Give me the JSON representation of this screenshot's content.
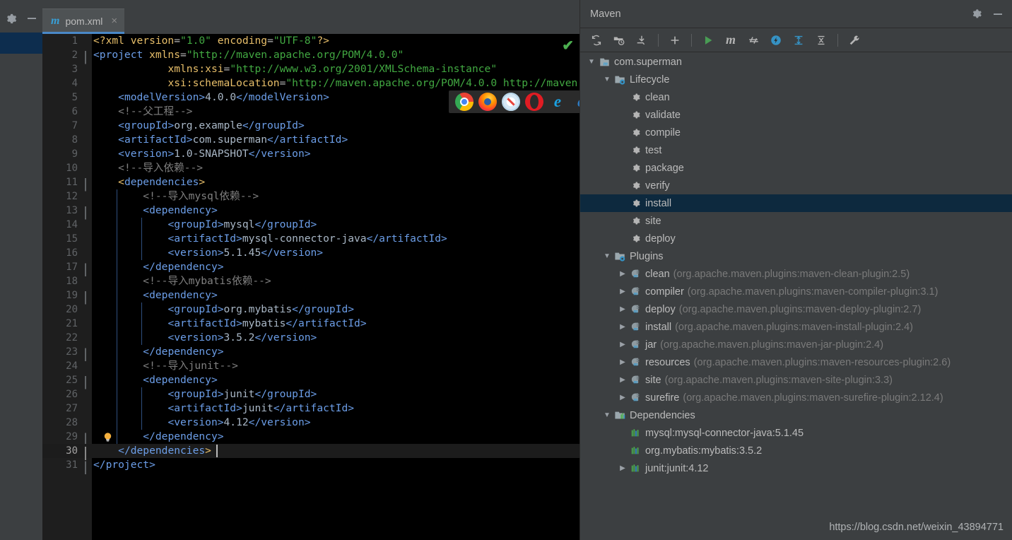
{
  "editor": {
    "tab": {
      "label": "pom.xml",
      "icon": "maven-m-icon",
      "close_icon": "×"
    },
    "toolbar_icons": [
      "gear-icon",
      "minimize-icon"
    ],
    "validation_status": "✔",
    "browser_icons": [
      "chrome-icon",
      "firefox-icon",
      "safari-icon",
      "opera-icon",
      "internet-explorer-icon",
      "edge-icon"
    ],
    "caret_line": 30,
    "lines": [
      {
        "n": 1,
        "html": "<span class='pi'>&lt;?xml </span><span class='attrn'>version</span><span class='attr'>=</span><span class='str'>\"1.0\"</span><span class='attr'> </span><span class='attrn'>encoding</span><span class='attr'>=</span><span class='str'>\"UTF-8\"</span><span class='pi'>?&gt;</span>"
      },
      {
        "n": 2,
        "html": "<span class='tagn'>&lt;project </span><span class='attrn'>xmlns</span><span class='attr'>=</span><span class='str'>\"http://maven.apache.org/POM/4.0.0\"</span>"
      },
      {
        "n": 3,
        "html": "            <span class='attrn'>xmlns:xsi</span><span class='attr'>=</span><span class='str'>\"http://www.w3.org/2001/XMLSchema-instance\"</span>"
      },
      {
        "n": 4,
        "html": "            <span class='attrn'>xsi:schemaLocation</span><span class='attr'>=</span><span class='str'>\"http://maven.apache.org/POM/4.0.0 http://maven.</span>"
      },
      {
        "n": 5,
        "html": "    <span class='tagn'>&lt;modelVersion&gt;</span><span class='txt'>4.0.0</span><span class='tagn'>&lt;/modelVersion&gt;</span>"
      },
      {
        "n": 6,
        "html": "    <span class='cmt'>&lt;!--父工程--&gt;</span>"
      },
      {
        "n": 7,
        "html": "    <span class='tagn'>&lt;groupId&gt;</span><span class='txt'>org.example</span><span class='tagn'>&lt;/groupId&gt;</span>"
      },
      {
        "n": 8,
        "html": "    <span class='tagn'>&lt;artifactId&gt;</span><span class='txt'>com.superman</span><span class='tagn'>&lt;/artifactId&gt;</span>"
      },
      {
        "n": 9,
        "html": "    <span class='tagn'>&lt;version&gt;</span><span class='txt'>1.0-SNAPSHOT</span><span class='tagn'>&lt;/version&gt;</span>"
      },
      {
        "n": 10,
        "html": "    <span class='cmt'>&lt;!--导入依赖--&gt;</span>"
      },
      {
        "n": 11,
        "html": "    <span class='br'>&lt;</span><span class='tagn'>dependencies</span><span class='br'>&gt;</span>"
      },
      {
        "n": 12,
        "html": "        <span class='cmt'>&lt;!--导入mysql依赖--&gt;</span>"
      },
      {
        "n": 13,
        "html": "        <span class='tagn'>&lt;dependency&gt;</span>"
      },
      {
        "n": 14,
        "html": "            <span class='tagn'>&lt;groupId&gt;</span><span class='txt'>mysql</span><span class='tagn'>&lt;/groupId&gt;</span>"
      },
      {
        "n": 15,
        "html": "            <span class='tagn'>&lt;artifactId&gt;</span><span class='txt'>mysql-connector-java</span><span class='tagn'>&lt;/artifactId&gt;</span>"
      },
      {
        "n": 16,
        "html": "            <span class='tagn'>&lt;version&gt;</span><span class='txt'>5.1.45</span><span class='tagn'>&lt;/version&gt;</span>"
      },
      {
        "n": 17,
        "html": "        <span class='tagn'>&lt;/dependency&gt;</span>"
      },
      {
        "n": 18,
        "html": "        <span class='cmt'>&lt;!--导入mybatis依赖--&gt;</span>"
      },
      {
        "n": 19,
        "html": "        <span class='tagn'>&lt;dependency&gt;</span>"
      },
      {
        "n": 20,
        "html": "            <span class='tagn'>&lt;groupId&gt;</span><span class='txt'>org.mybatis</span><span class='tagn'>&lt;/groupId&gt;</span>"
      },
      {
        "n": 21,
        "html": "            <span class='tagn'>&lt;artifactId&gt;</span><span class='txt'>mybatis</span><span class='tagn'>&lt;/artifactId&gt;</span>"
      },
      {
        "n": 22,
        "html": "            <span class='tagn'>&lt;version&gt;</span><span class='txt'>3.5.2</span><span class='tagn'>&lt;/version&gt;</span>"
      },
      {
        "n": 23,
        "html": "        <span class='tagn'>&lt;/dependency&gt;</span>"
      },
      {
        "n": 24,
        "html": "        <span class='cmt'>&lt;!--导入junit--&gt;</span>"
      },
      {
        "n": 25,
        "html": "        <span class='tagn'>&lt;dependency&gt;</span>"
      },
      {
        "n": 26,
        "html": "            <span class='tagn'>&lt;groupId&gt;</span><span class='txt'>junit</span><span class='tagn'>&lt;/groupId&gt;</span>"
      },
      {
        "n": 27,
        "html": "            <span class='tagn'>&lt;artifactId&gt;</span><span class='txt'>junit</span><span class='tagn'>&lt;/artifactId&gt;</span>"
      },
      {
        "n": 28,
        "html": "            <span class='tagn'>&lt;version&gt;</span><span class='txt'>4.12</span><span class='tagn'>&lt;/version&gt;</span>"
      },
      {
        "n": 29,
        "html": "        <span class='tagn'>&lt;/dependency&gt;</span>"
      },
      {
        "n": 30,
        "html": "    <span class='tagn'>&lt;/dependencies</span><span class='br'>&gt;</span>"
      },
      {
        "n": 31,
        "html": "<span class='tagn'>&lt;/project&gt;</span>"
      }
    ],
    "plain_lines": [
      "<?xml version=\"1.0\" encoding=\"UTF-8\"?>",
      "<project xmlns=\"http://maven.apache.org/POM/4.0.0\"",
      "         xmlns:xsi=\"http://www.w3.org/2001/XMLSchema-instance\"",
      "         xsi:schemaLocation=\"http://maven.apache.org/POM/4.0.0 http://maven.",
      "    <modelVersion>4.0.0</modelVersion>",
      "    <!--父工程-->",
      "    <groupId>org.example</groupId>",
      "    <artifactId>com.superman</artifactId>",
      "    <version>1.0-SNAPSHOT</version>",
      "    <!--导入依赖-->",
      "    <dependencies>",
      "        <!--导入mysql依赖-->",
      "        <dependency>",
      "            <groupId>mysql</groupId>",
      "            <artifactId>mysql-connector-java</artifactId>",
      "            <version>5.1.45</version>",
      "        </dependency>",
      "        <!--导入mybatis依赖-->",
      "        <dependency>",
      "            <groupId>org.mybatis</groupId>",
      "            <artifactId>mybatis</artifactId>",
      "            <version>3.5.2</version>",
      "        </dependency>",
      "        <!--导入junit-->",
      "        <dependency>",
      "            <groupId>junit</groupId>",
      "            <artifactId>junit</artifactId>",
      "            <version>4.12</version>",
      "        </dependency>",
      "    </dependencies>",
      "</project>"
    ]
  },
  "maven": {
    "title": "Maven",
    "header_icons": [
      "gear-icon",
      "minimize-icon"
    ],
    "toolbar": [
      {
        "name": "reimport-icon",
        "tip": "Reimport All Maven Projects"
      },
      {
        "name": "generate-sources-icon",
        "tip": "Generate Sources and Update Folders"
      },
      {
        "name": "download-sources-icon",
        "tip": "Download Sources and/or Documentation"
      },
      {
        "name": "add-maven-project-icon",
        "tip": "Add Maven Projects"
      },
      {
        "name": "run-icon",
        "tip": "Execute Maven Goal"
      },
      {
        "name": "maven-settings-icon",
        "tip": "Maven Settings"
      },
      {
        "name": "toggle-skip-tests-icon",
        "tip": "Toggle Skip Tests Mode"
      },
      {
        "name": "toggle-offline-icon",
        "tip": "Toggle Offline Mode"
      },
      {
        "name": "show-dependencies-icon",
        "tip": "Show Dependencies"
      },
      {
        "name": "collapse-all-icon",
        "tip": "Collapse All"
      },
      {
        "name": "maven-settings-wrench-icon",
        "tip": "Settings"
      }
    ],
    "tree": [
      {
        "id": "root",
        "label": "com.superman",
        "sub": "",
        "indent": 0,
        "arrow": "down",
        "icon": "maven-project-icon",
        "selected": false
      },
      {
        "id": "lifecycle",
        "label": "Lifecycle",
        "sub": "",
        "indent": 1,
        "arrow": "down",
        "icon": "lifecycle-folder-icon",
        "selected": false
      },
      {
        "id": "clean",
        "label": "clean",
        "sub": "",
        "indent": 2,
        "arrow": "none",
        "icon": "goal-gear-icon",
        "selected": false
      },
      {
        "id": "validate",
        "label": "validate",
        "sub": "",
        "indent": 2,
        "arrow": "none",
        "icon": "goal-gear-icon",
        "selected": false
      },
      {
        "id": "compile",
        "label": "compile",
        "sub": "",
        "indent": 2,
        "arrow": "none",
        "icon": "goal-gear-icon",
        "selected": false
      },
      {
        "id": "test",
        "label": "test",
        "sub": "",
        "indent": 2,
        "arrow": "none",
        "icon": "goal-gear-icon",
        "selected": false
      },
      {
        "id": "package",
        "label": "package",
        "sub": "",
        "indent": 2,
        "arrow": "none",
        "icon": "goal-gear-icon",
        "selected": false
      },
      {
        "id": "verify",
        "label": "verify",
        "sub": "",
        "indent": 2,
        "arrow": "none",
        "icon": "goal-gear-icon",
        "selected": false
      },
      {
        "id": "install",
        "label": "install",
        "sub": "",
        "indent": 2,
        "arrow": "none",
        "icon": "goal-gear-icon",
        "selected": true
      },
      {
        "id": "site",
        "label": "site",
        "sub": "",
        "indent": 2,
        "arrow": "none",
        "icon": "goal-gear-icon",
        "selected": false
      },
      {
        "id": "deploy",
        "label": "deploy",
        "sub": "",
        "indent": 2,
        "arrow": "none",
        "icon": "goal-gear-icon",
        "selected": false
      },
      {
        "id": "plugins",
        "label": "Plugins",
        "sub": "",
        "indent": 1,
        "arrow": "down",
        "icon": "plugins-folder-icon",
        "selected": false
      },
      {
        "id": "plugin-clean",
        "label": "clean",
        "sub": "(org.apache.maven.plugins:maven-clean-plugin:2.5)",
        "indent": 2,
        "arrow": "right",
        "icon": "plugin-icon",
        "selected": false
      },
      {
        "id": "plugin-compiler",
        "label": "compiler",
        "sub": "(org.apache.maven.plugins:maven-compiler-plugin:3.1)",
        "indent": 2,
        "arrow": "right",
        "icon": "plugin-icon",
        "selected": false
      },
      {
        "id": "plugin-deploy",
        "label": "deploy",
        "sub": "(org.apache.maven.plugins:maven-deploy-plugin:2.7)",
        "indent": 2,
        "arrow": "right",
        "icon": "plugin-icon",
        "selected": false
      },
      {
        "id": "plugin-install",
        "label": "install",
        "sub": "(org.apache.maven.plugins:maven-install-plugin:2.4)",
        "indent": 2,
        "arrow": "right",
        "icon": "plugin-icon",
        "selected": false
      },
      {
        "id": "plugin-jar",
        "label": "jar",
        "sub": "(org.apache.maven.plugins:maven-jar-plugin:2.4)",
        "indent": 2,
        "arrow": "right",
        "icon": "plugin-icon",
        "selected": false
      },
      {
        "id": "plugin-resources",
        "label": "resources",
        "sub": "(org.apache.maven.plugins:maven-resources-plugin:2.6)",
        "indent": 2,
        "arrow": "right",
        "icon": "plugin-icon",
        "selected": false
      },
      {
        "id": "plugin-site",
        "label": "site",
        "sub": "(org.apache.maven.plugins:maven-site-plugin:3.3)",
        "indent": 2,
        "arrow": "right",
        "icon": "plugin-icon",
        "selected": false
      },
      {
        "id": "plugin-surefire",
        "label": "surefire",
        "sub": "(org.apache.maven.plugins:maven-surefire-plugin:2.12.4)",
        "indent": 2,
        "arrow": "right",
        "icon": "plugin-icon",
        "selected": false
      },
      {
        "id": "dependencies",
        "label": "Dependencies",
        "sub": "",
        "indent": 1,
        "arrow": "down",
        "icon": "dependencies-folder-icon",
        "selected": false
      },
      {
        "id": "dep-mysql",
        "label": "mysql:mysql-connector-java:5.1.45",
        "sub": "",
        "indent": 2,
        "arrow": "none",
        "icon": "dependency-icon",
        "selected": false
      },
      {
        "id": "dep-mybatis",
        "label": "org.mybatis:mybatis:3.5.2",
        "sub": "",
        "indent": 2,
        "arrow": "none",
        "icon": "dependency-icon",
        "selected": false
      },
      {
        "id": "dep-junit",
        "label": "junit:junit:4.12",
        "sub": "",
        "indent": 2,
        "arrow": "right",
        "icon": "dependency-icon",
        "selected": false
      }
    ]
  },
  "watermark": {
    "text": "https://blog.csdn.net/weixin_43894771"
  },
  "colors": {
    "panel_bg": "#3c3f41",
    "editor_bg": "#000000",
    "selection_blue": "#0d293e",
    "tab_underline": "#4a88c7",
    "accent_green": "#4caf50",
    "tag_blue": "#6c9ee8",
    "string_green": "#42a942",
    "attr_orange": "#e8bf6a",
    "comment_gray": "#808080"
  }
}
